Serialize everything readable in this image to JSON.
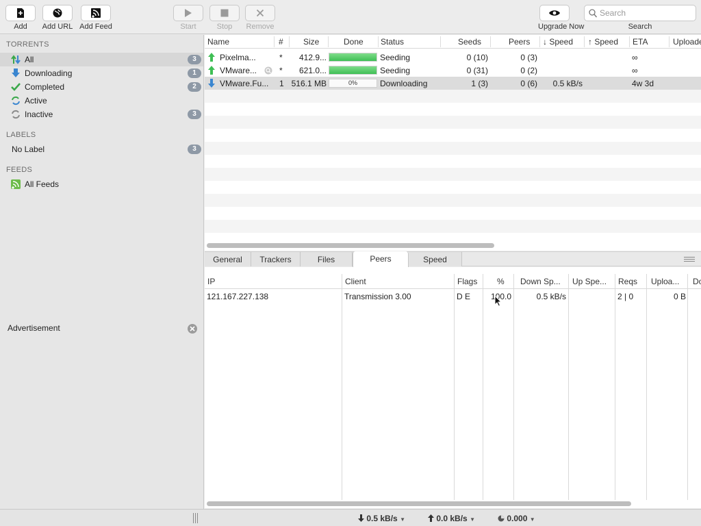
{
  "toolbar": {
    "add": "Add",
    "add_url": "Add URL",
    "add_feed": "Add Feed",
    "start": "Start",
    "stop": "Stop",
    "remove": "Remove",
    "upgrade": "Upgrade Now",
    "search_placeholder": "Search",
    "search_label": "Search"
  },
  "sidebar": {
    "torrents_heading": "TORRENTS",
    "torrents": [
      {
        "label": "All",
        "count": "3",
        "icon": "up-down-arrows-icon"
      },
      {
        "label": "Downloading",
        "count": "1",
        "icon": "download-arrow-icon"
      },
      {
        "label": "Completed",
        "count": "2",
        "icon": "checkmark-icon"
      },
      {
        "label": "Active",
        "count": "",
        "icon": "refresh-icon"
      },
      {
        "label": "Inactive",
        "count": "3",
        "icon": "inactive-icon"
      }
    ],
    "labels_heading": "LABELS",
    "labels": [
      {
        "label": "No Label",
        "count": "3"
      }
    ],
    "feeds_heading": "FEEDS",
    "feeds": [
      {
        "label": "All Feeds",
        "icon": "rss-icon"
      }
    ],
    "advertisement": "Advertisement"
  },
  "torrent_table": {
    "columns": [
      "Name",
      "#",
      "Size",
      "Done",
      "Status",
      "Seeds",
      "Peers",
      "↓ Speed",
      "↑ Speed",
      "ETA",
      "Uploaded"
    ],
    "rows": [
      {
        "name": "Pixelma...",
        "num": "*",
        "size": "412.9...",
        "done": 100,
        "done_label": "",
        "status": "Seeding",
        "seeds": "0 (10)",
        "peers": "0 (3)",
        "down": "",
        "up": "",
        "eta": "∞",
        "direction": "up"
      },
      {
        "name": "VMware...",
        "num": "*",
        "size": "621.0...",
        "done": 100,
        "done_label": "",
        "status": "Seeding",
        "seeds": "0 (31)",
        "peers": "0 (2)",
        "down": "",
        "up": "",
        "eta": "∞",
        "direction": "up"
      },
      {
        "name": "VMware.Fu...",
        "num": "1",
        "size": "516.1 MB",
        "done": 0,
        "done_label": "0%",
        "status": "Downloading",
        "seeds": "1 (3)",
        "peers": "0 (6)",
        "down": "0.5 kB/s",
        "up": "",
        "eta": "4w 3d",
        "direction": "down"
      }
    ]
  },
  "tabs": [
    "General",
    "Trackers",
    "Files",
    "Peers",
    "Speed"
  ],
  "active_tab": "Peers",
  "peers_table": {
    "columns": [
      "IP",
      "Client",
      "Flags",
      "%",
      "Down Sp...",
      "Up Spe...",
      "Reqs",
      "Uploa...",
      "Do"
    ],
    "rows": [
      {
        "ip": "121.167.227.138",
        "client": "Transmission 3.00",
        "flags": "D E",
        "percent": "100.0",
        "down": "0.5 kB/s",
        "up": "",
        "reqs": "2 | 0",
        "uploaded": "0 B",
        "dl": ""
      }
    ]
  },
  "status_bar": {
    "down_speed": "0.5 kB/s",
    "up_speed": "0.0 kB/s",
    "ratio": "0.000"
  }
}
